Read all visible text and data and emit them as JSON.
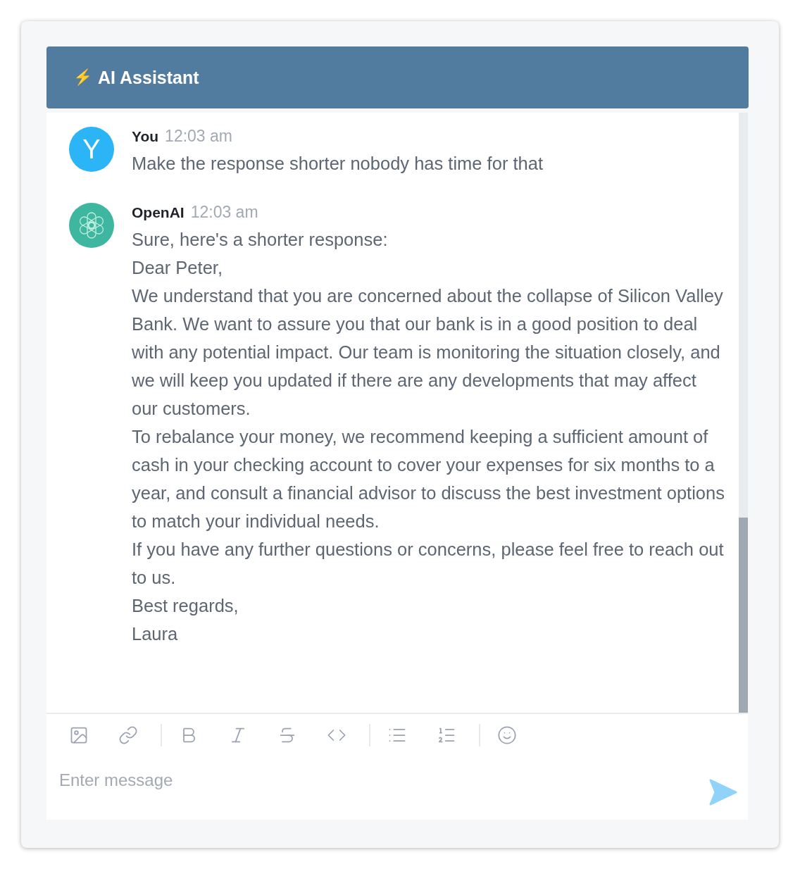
{
  "header": {
    "icon": "⚡",
    "title": "AI Assistant"
  },
  "messages": [
    {
      "kind": "user",
      "avatar": "Y",
      "author": "You",
      "time": "12:03 am",
      "lines": [
        "Make the response shorter nobody has time for that"
      ]
    },
    {
      "kind": "bot",
      "author": "OpenAI",
      "time": "12:03 am",
      "lines": [
        "Sure, here's a shorter response:",
        "Dear Peter,",
        "We understand that you are concerned about the collapse of Silicon Valley Bank. We want to assure you that our bank is in a good position to deal with any potential impact. Our team is monitoring the situation closely, and we will keep you updated if there are any developments that may affect our customers.",
        "To rebalance your money, we recommend keeping a sufficient amount of cash in your checking account to cover your expenses for six months to a year, and consult a financial advisor to discuss the best investment options to match your individual needs.",
        "If you have any further questions or concerns, please feel free to reach out to us.",
        "Best regards,",
        "Laura"
      ]
    }
  ],
  "toolbar": [
    {
      "kind": "image"
    },
    {
      "kind": "link"
    },
    {
      "kind": "divider"
    },
    {
      "kind": "bold"
    },
    {
      "kind": "italic"
    },
    {
      "kind": "strike"
    },
    {
      "kind": "code"
    },
    {
      "kind": "divider"
    },
    {
      "kind": "bullets"
    },
    {
      "kind": "numbers"
    },
    {
      "kind": "divider"
    },
    {
      "kind": "emoji"
    }
  ],
  "composer": {
    "placeholder": "Enter message"
  }
}
